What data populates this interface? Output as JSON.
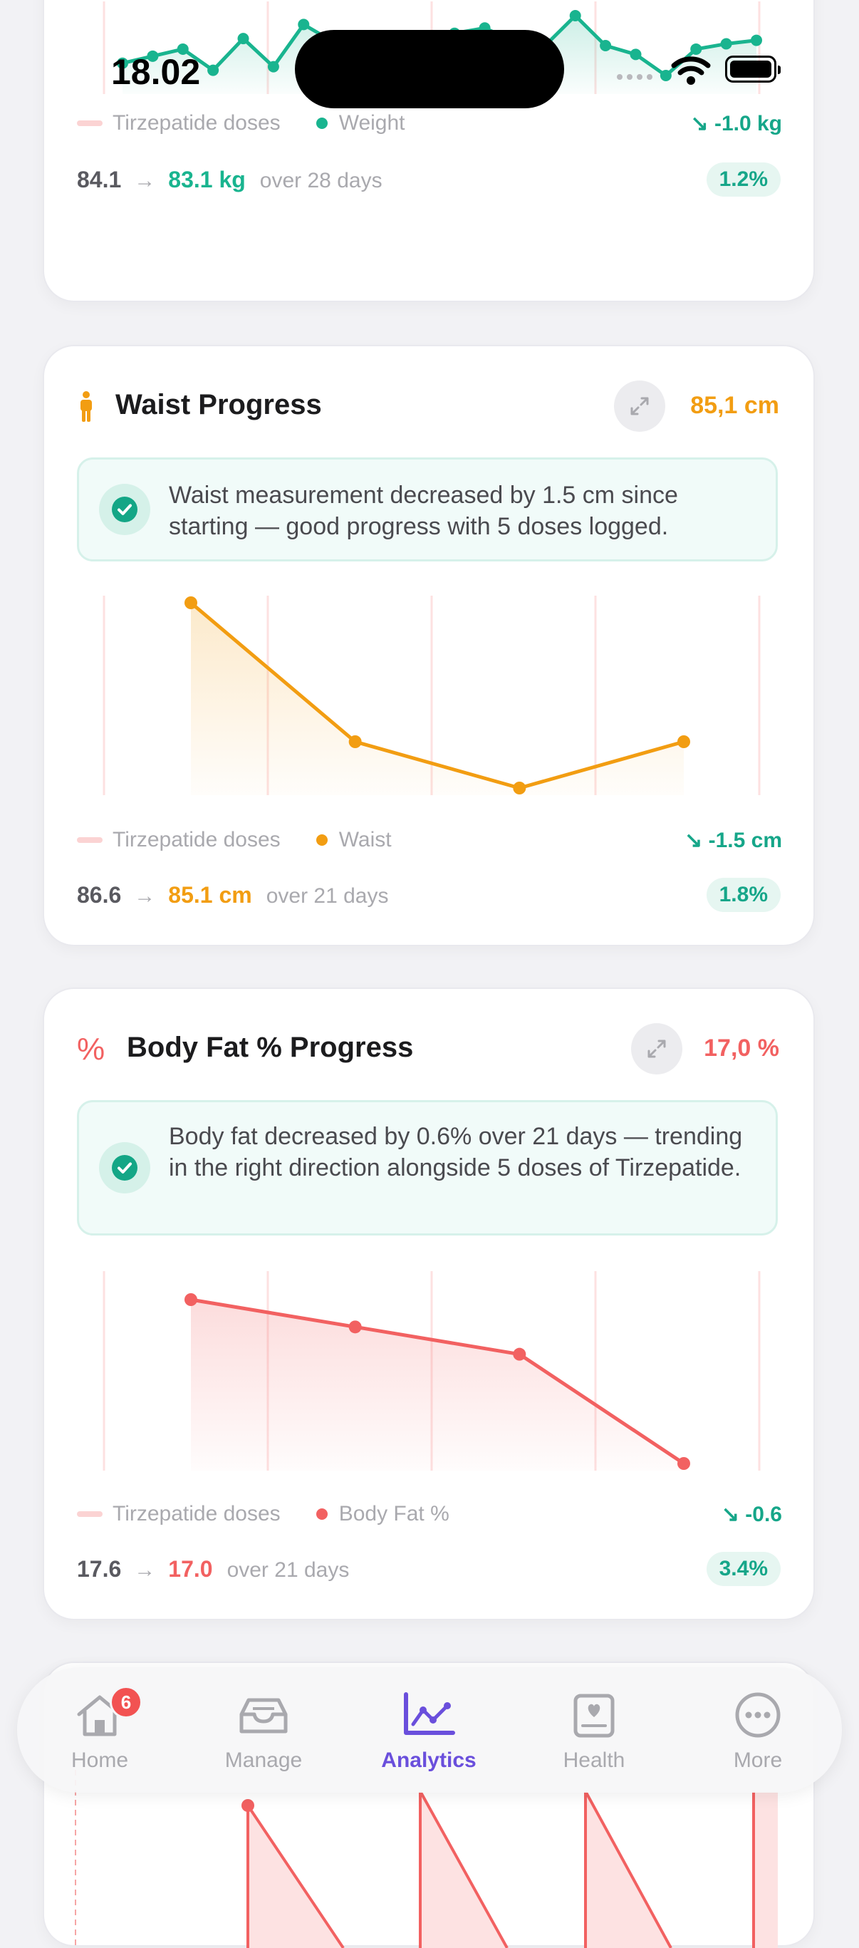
{
  "status_bar": {
    "time": "18.02"
  },
  "weight_card": {
    "legend_doses": "Tirzepatide doses",
    "legend_metric": "Weight",
    "change": "-1.0 kg",
    "start": "84.1",
    "end": "83.1 kg",
    "period": "over 28 days",
    "pct": "1.2%",
    "color": "#19b48f",
    "points": [
      88,
      92,
      96,
      84,
      102,
      86,
      110,
      100,
      99,
      94,
      96,
      105,
      108,
      100,
      98,
      115,
      98,
      93,
      81,
      96,
      99,
      101
    ]
  },
  "waist_card": {
    "title": "Waist Progress",
    "value": "85,1 cm",
    "insight": "Waist measurement decreased by 1.5 cm since starting — good progress with 5 doses logged.",
    "legend_doses": "Tirzepatide doses",
    "legend_metric": "Waist",
    "change": "-1.5 cm",
    "start": "86.6",
    "end": "85.1 cm",
    "period": "over 21 days",
    "pct": "1.8%",
    "color": "#f29d12",
    "points": [
      86.6,
      85.4,
      85.0,
      85.4
    ]
  },
  "bodyfat_card": {
    "icon_glyph": "%",
    "title": "Body Fat % Progress",
    "value": "17,0 %",
    "insight": "Body fat decreased by 0.6% over 21 days — trending in the right direction alongside 5 doses of Tirzepatide.",
    "legend_doses": "Tirzepatide doses",
    "legend_metric": "Body Fat %",
    "change": "-0.6",
    "start": "17.6",
    "end": "17.0",
    "period": "over 21 days",
    "pct": "3.4%",
    "color": "#f26161",
    "points": [
      17.6,
      17.5,
      17.4,
      17.0
    ]
  },
  "tab_bar": {
    "home_badge": "6",
    "items": [
      {
        "label": "Home",
        "icon": "house-icon"
      },
      {
        "label": "Manage",
        "icon": "tray-icon"
      },
      {
        "label": "Analytics",
        "icon": "chart-icon"
      },
      {
        "label": "Health",
        "icon": "heart-card-icon"
      },
      {
        "label": "More",
        "icon": "ellipsis-icon"
      }
    ],
    "active_color": "#6a4fdc",
    "inactive_color": "#a9a9ae"
  }
}
